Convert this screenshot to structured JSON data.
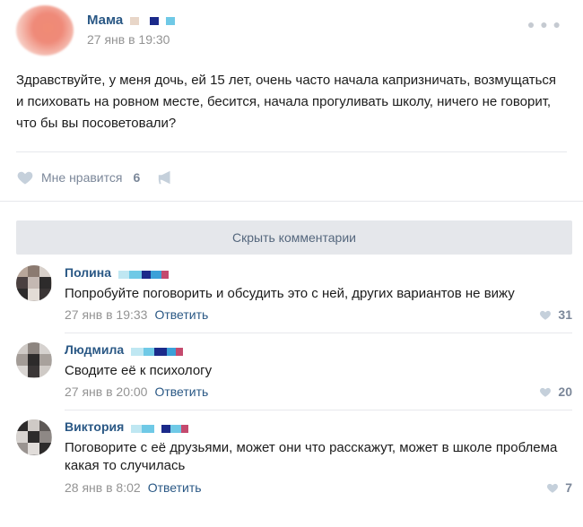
{
  "colors": {
    "link": "#2a5885",
    "muted": "#939393",
    "action": "#7b8799",
    "like_icon": "#c5d0db"
  },
  "post": {
    "author": "Мама",
    "date": "27 янв в 19:30",
    "more_icon": "more-dots-icon",
    "text": "Здравствуйте, у меня дочь, ей 15 лет, очень часто начала капризничать, возмущаться и психовать на ровном месте, бесится, начала прогуливать школу, ничего не говорит, что бы вы посоветовали?",
    "like_label": "Мне нравится",
    "like_count": "6",
    "hide_comments_label": "Скрыть комментарии"
  },
  "comments": [
    {
      "name": "Полина",
      "text": "Попробуйте поговорить и обсудить это с ней, других вариантов не вижу",
      "date": "27 янв в 19:33",
      "reply": "Ответить",
      "likes": "31"
    },
    {
      "name": "Людмила",
      "text": "Сводите её к психологу",
      "date": "27 янв в 20:00",
      "reply": "Ответить",
      "likes": "20"
    },
    {
      "name": "Виктория",
      "text": "Поговорите с её друзьями, может они что расскажут, может в школе проблема какая то случилась",
      "date": "28 янв в 8:02",
      "reply": "Ответить",
      "likes": "7"
    }
  ]
}
